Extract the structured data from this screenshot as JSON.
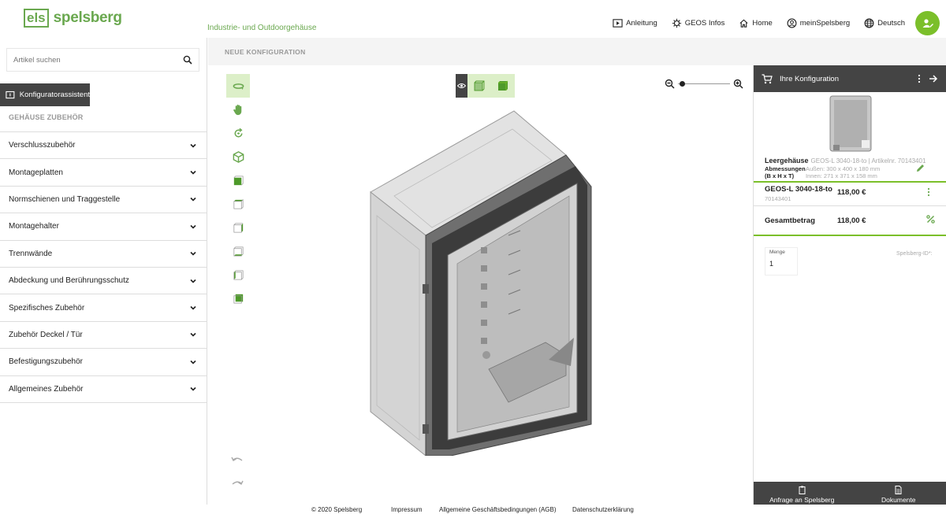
{
  "header": {
    "logo_mark": "els",
    "logo_text": "spelsberg",
    "tagline": "Industrie- und Outdoorgehäuse",
    "nav": [
      {
        "label": "Anleitung",
        "icon": "play-icon"
      },
      {
        "label": "GEOS Infos",
        "icon": "gear-icon"
      },
      {
        "label": "Home",
        "icon": "home-icon"
      },
      {
        "label": "meinSpelsberg",
        "icon": "user-circle-icon"
      },
      {
        "label": "Deutsch",
        "icon": "globe-icon"
      }
    ]
  },
  "sidebar": {
    "search_placeholder": "Artikel suchen",
    "assistant_label": "Konfiguratorassistent",
    "section_label": "GEHÄUSE ZUBEHÖR",
    "items": [
      {
        "label": "Verschlusszubehör"
      },
      {
        "label": "Montageplatten"
      },
      {
        "label": "Normschienen und Traggestelle"
      },
      {
        "label": "Montagehalter"
      },
      {
        "label": "Trennwände"
      },
      {
        "label": "Abdeckung und Berührungsschutz"
      },
      {
        "label": "Spezifisches Zubehör"
      },
      {
        "label": "Zubehör Deckel / Tür"
      },
      {
        "label": "Befestigungszubehör"
      },
      {
        "label": "Allgemeines Zubehör"
      }
    ]
  },
  "main": {
    "title": "NEUE KONFIGURATION"
  },
  "config": {
    "title": "Ihre Konfiguration",
    "product_type": "Leergehäuse",
    "product_info": "GEOS-L 3040-18-to | Artikelnr. 70143401",
    "dims_label": "Abmessungen",
    "dims_sub": "(B x H x T)",
    "dims_outer": "Außen: 300 x 400 x 180 mm",
    "dims_inner": "Innen: 271 x 371 x 158 mm",
    "item_name": "GEOS-L 3040-18-to",
    "item_art": "70143401",
    "item_price": "118,00 €",
    "total_label": "Gesamtbetrag",
    "total_price": "118,00 €",
    "qty_label": "Menge",
    "qty_value": "1",
    "spelsberg_id_label": "Spelsberg-ID*:",
    "request_label": "Anfrage an Spelsberg",
    "documents_label": "Dokumente"
  },
  "footer": {
    "copyright": "© 2020 Spelsberg",
    "imprint": "Impressum",
    "terms": "Allgemeine Geschäftsbedingungen (AGB)",
    "privacy": "Datenschutzerklärung"
  },
  "colors": {
    "brand_green": "#6aa84f",
    "accent_green": "#7bbf2a",
    "dark_bar": "#444444"
  }
}
